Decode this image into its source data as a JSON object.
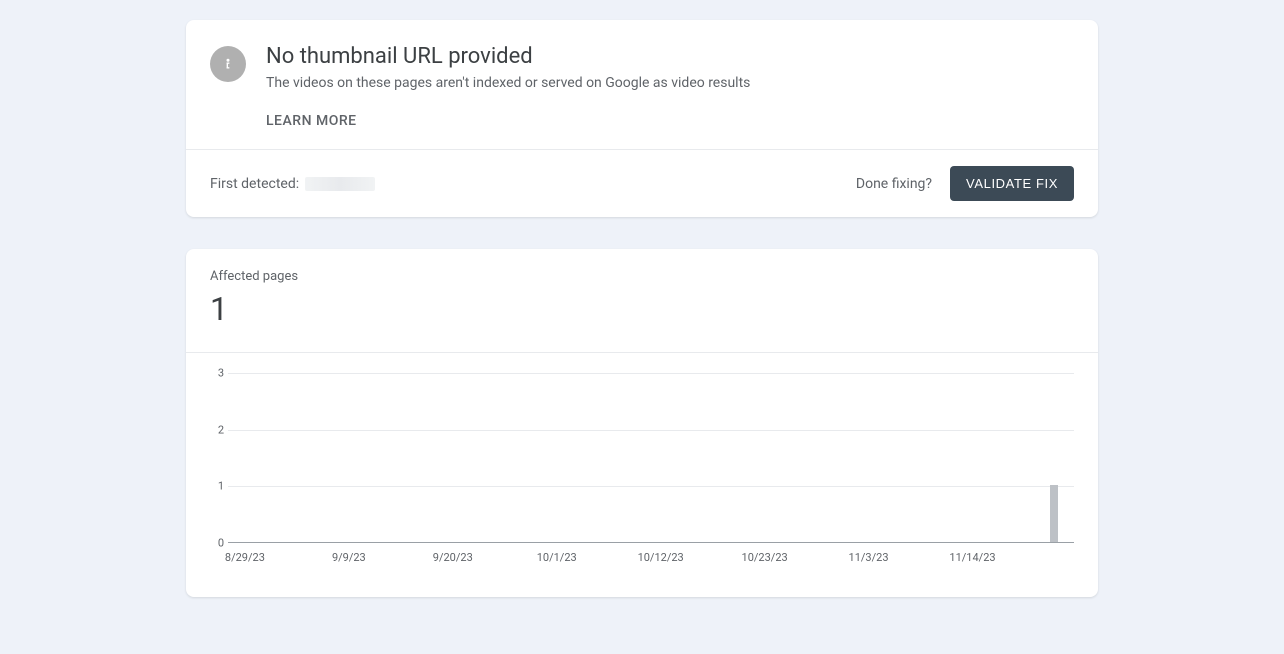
{
  "issue": {
    "title": "No thumbnail URL provided",
    "description": "The videos on these pages aren't indexed or served on Google as video results",
    "learn_more": "LEARN MORE",
    "first_detected_label": "First detected:",
    "done_fixing_label": "Done fixing?",
    "validate_fix_label": "VALIDATE FIX"
  },
  "affected": {
    "label": "Affected pages",
    "count": "1"
  },
  "chart_data": {
    "type": "bar",
    "y_ticks": [
      0,
      1,
      2,
      3
    ],
    "ylim": [
      0,
      3
    ],
    "x_labels": [
      "8/29/23",
      "9/9/23",
      "9/20/23",
      "10/1/23",
      "10/12/23",
      "10/23/23",
      "11/3/23",
      "11/14/23"
    ],
    "series": [
      {
        "name": "Affected pages",
        "values_at_end": 1
      }
    ],
    "bars": [
      {
        "x_percent": 97.2,
        "value": 1
      }
    ]
  }
}
